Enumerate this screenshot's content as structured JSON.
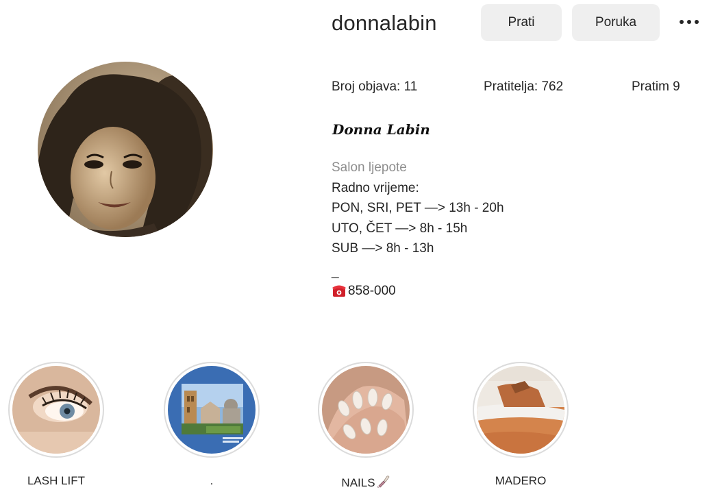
{
  "profile": {
    "username": "donnalabin",
    "follow_label": "Prati",
    "message_label": "Poruka",
    "more_icon": "more-horizontal-icon",
    "full_name": "Donna Labin"
  },
  "stats": {
    "posts": "Broj objava: 11",
    "followers": "Pratitelja: 762",
    "following": "Pratim 9"
  },
  "bio": {
    "category": "Salon ljepote",
    "lines": [
      "Radno vrijeme:",
      "PON, SRI, PET —> 13h - 20h",
      "UTO, ČET —> 8h - 15h",
      "SUB —> 8h - 13h"
    ],
    "separator": "_",
    "phone_icon": "telephone-icon",
    "phone": "858-000"
  },
  "highlights": [
    {
      "label": "LASH LIFT"
    },
    {
      "label": "."
    },
    {
      "label": "NAILS",
      "emoji_icon": "nail-polish-icon"
    },
    {
      "label": "MADERO"
    }
  ],
  "colors": {
    "text": "#262626",
    "secondary_text": "#8e8e8e",
    "button_bg": "#efefef",
    "highlight_ring": "#dbdbdb",
    "phone_red": "#d0202a"
  }
}
